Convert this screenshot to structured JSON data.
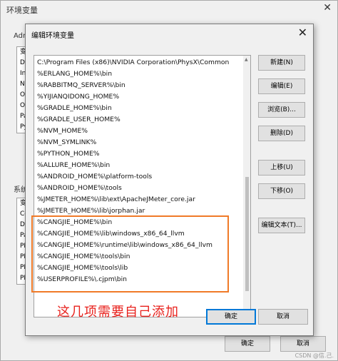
{
  "outer": {
    "title": "环境变量",
    "close": "✕",
    "user_group_label": "Adm",
    "user_list": [
      "变",
      "Dc",
      "In",
      "NV",
      "On",
      "OI",
      "Pa",
      "Py"
    ],
    "system_group_label": "系统",
    "system_list": [
      "变",
      "Co",
      "Dr",
      "Pa",
      "PR",
      "PR",
      "PR",
      "PR"
    ],
    "ok": "确定",
    "cancel": "取消"
  },
  "dialog": {
    "title": "编辑环境变量",
    "close": "✕",
    "paths": [
      "C:\\Program Files (x86)\\NVIDIA Corporation\\PhysX\\Common",
      "%ERLANG_HOME%\\bin",
      "%RABBITMQ_SERVER%\\bin",
      "%YIJIANQIDONG_HOME%",
      "%GRADLE_HOME%\\bin",
      "%GRADLE_USER_HOME%",
      "%NVM_HOME%",
      "%NVM_SYMLINK%",
      "%PYTHON_HOME%",
      "%ALLURE_HOME%\\bin",
      "%ANDROID_HOME%\\platform-tools",
      "%ANDROID_HOME%\\tools",
      "%JMETER_HOME%\\lib\\ext\\ApacheJMeter_core.jar",
      "%JMETER_HOME%\\lib\\jorphan.jar",
      "%CANGJIE_HOME%\\bin",
      "%CANGJIE_HOME%\\lib\\windows_x86_64_llvm",
      "%CANGJIE_HOME%\\runtime\\lib\\windows_x86_64_llvm",
      "%CANGJIE_HOME%\\tools\\bin",
      "%CANGJIE_HOME%\\tools\\lib",
      "%USERPROFILE%\\.cjpm\\bin"
    ],
    "buttons": {
      "new": "新建(N)",
      "edit": "编辑(E)",
      "browse": "浏览(B)...",
      "delete": "删除(D)",
      "move_up": "上移(U)",
      "move_down": "下移(O)",
      "edit_text": "编辑文本(T)...",
      "ok": "确定",
      "cancel": "取消"
    },
    "annotation": "这几项需要自己添加"
  },
  "watermark": "CSDN @信.己."
}
